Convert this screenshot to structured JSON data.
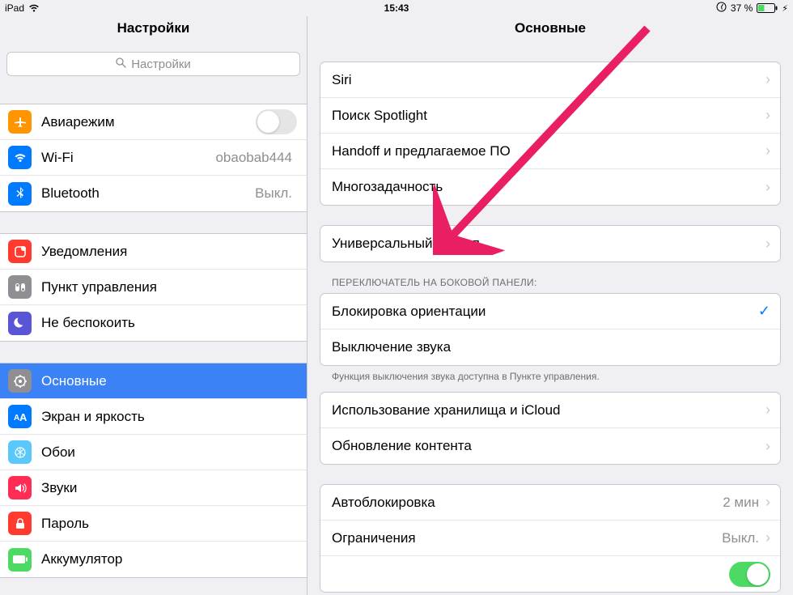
{
  "statusbar": {
    "device": "iPad",
    "time": "15:43",
    "battery": "37 %"
  },
  "sidebar": {
    "title": "Настройки",
    "search_placeholder": "Настройки",
    "items": [
      {
        "key": "airplane",
        "label": "Авиарежим",
        "toggle": false
      },
      {
        "key": "wifi",
        "label": "Wi-Fi",
        "value": "obaobab444"
      },
      {
        "key": "bluetooth",
        "label": "Bluetooth",
        "value": "Выкл."
      },
      {
        "key": "notifications",
        "label": "Уведомления"
      },
      {
        "key": "controlcenter",
        "label": "Пункт управления"
      },
      {
        "key": "dnd",
        "label": "Не беспокоить"
      },
      {
        "key": "general",
        "label": "Основные"
      },
      {
        "key": "display",
        "label": "Экран и яркость"
      },
      {
        "key": "wallpaper",
        "label": "Обои"
      },
      {
        "key": "sounds",
        "label": "Звуки"
      },
      {
        "key": "passcode",
        "label": "Пароль"
      },
      {
        "key": "battery",
        "label": "Аккумулятор"
      }
    ]
  },
  "content": {
    "title": "Основные",
    "group1": [
      {
        "key": "siri",
        "label": "Siri"
      },
      {
        "key": "spotlight",
        "label": "Поиск Spotlight"
      },
      {
        "key": "handoff",
        "label": "Handoff и предлагаемое ПО"
      },
      {
        "key": "multitask",
        "label": "Многозадачность"
      }
    ],
    "group2": [
      {
        "key": "accessibility",
        "label": "Универсальный доступ"
      }
    ],
    "sideswitch_header": "ПЕРЕКЛЮЧАТЕЛЬ НА БОКОВОЙ ПАНЕЛИ:",
    "group3": [
      {
        "key": "lockrot",
        "label": "Блокировка ориентации",
        "checked": true
      },
      {
        "key": "mute",
        "label": "Выключение звука",
        "checked": false
      }
    ],
    "sideswitch_footer": "Функция выключения звука доступна в Пункте управления.",
    "group4": [
      {
        "key": "storage",
        "label": "Использование хранилища и iCloud"
      },
      {
        "key": "refresh",
        "label": "Обновление контента"
      }
    ],
    "group5": [
      {
        "key": "autolock",
        "label": "Автоблокировка",
        "value": "2 мин"
      },
      {
        "key": "restrictions",
        "label": "Ограничения",
        "value": "Выкл."
      }
    ]
  }
}
